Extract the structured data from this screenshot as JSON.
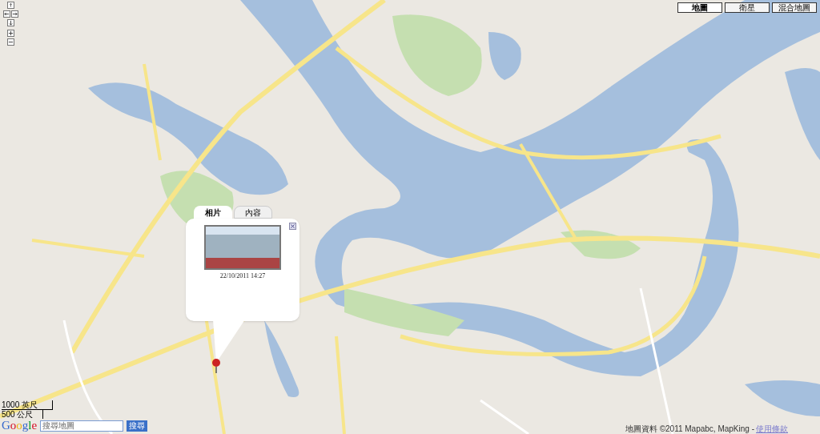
{
  "map_types": [
    {
      "label": "地圖",
      "selected": true
    },
    {
      "label": "衛星",
      "selected": false
    },
    {
      "label": "混合地圖",
      "selected": false
    }
  ],
  "info_window": {
    "tabs": [
      {
        "label": "相片",
        "selected": true
      },
      {
        "label": "內容",
        "selected": false
      }
    ],
    "caption": "22/10/2011 14:27"
  },
  "scale": {
    "imperial": "1000 英尺",
    "metric": "500 公尺"
  },
  "logo": "Google",
  "search": {
    "placeholder": "搜尋地圖",
    "button": "搜尋"
  },
  "attribution": {
    "text": "地圖資料 ©2011 Mapabc, MapKing -",
    "link": "使用條款"
  }
}
